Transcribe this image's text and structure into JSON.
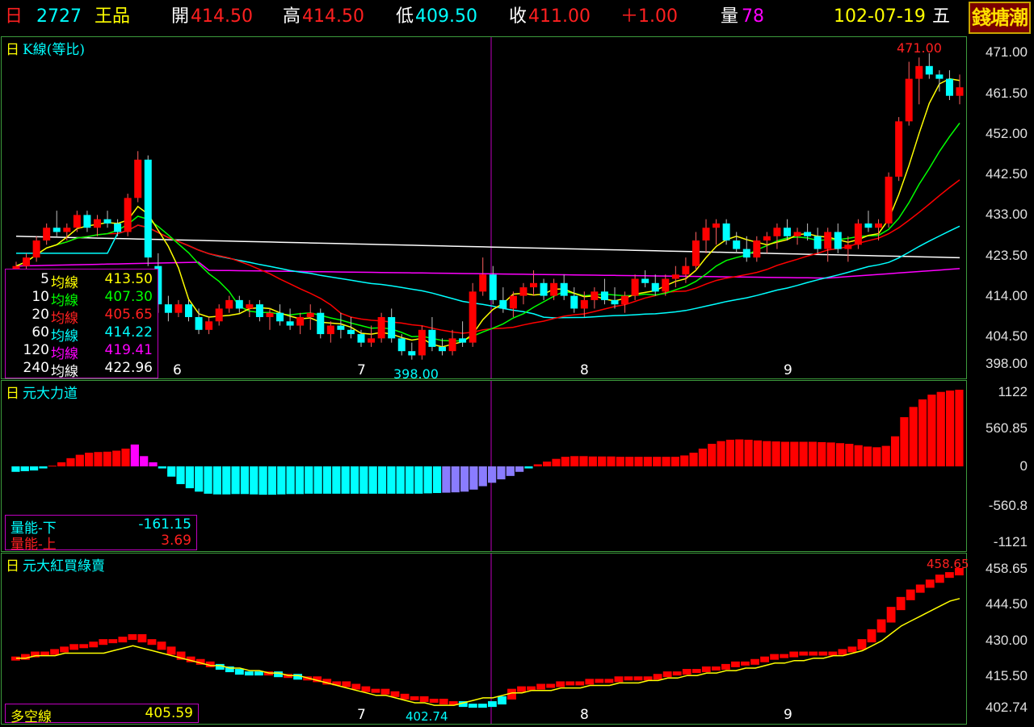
{
  "topbar": {
    "period": "日",
    "code": "2727",
    "name": "王品",
    "open_label": "開",
    "open": "414.50",
    "high_label": "高",
    "high": "414.50",
    "low_label": "低",
    "low": "409.50",
    "close_label": "收",
    "close": "411.00",
    "change": "＋1.00",
    "volume_label": "量",
    "volume": "78",
    "date": "102-07-19",
    "weekday": "五",
    "logo": "錢塘潮"
  },
  "colors": {
    "up": "#ff0000",
    "down": "#00ffff",
    "ma5": "#ffff00",
    "ma10": "#00ff00",
    "ma20": "#ff0000",
    "ma60": "#00ffff",
    "ma120": "#ff00ff",
    "ma240": "#ffffff",
    "grid": "#3c9c3c",
    "cursor": "#c000c0"
  },
  "panel1": {
    "title_prefix": "日",
    "title": "K線(等比)",
    "max_label": "471.00",
    "min_label": "398.00",
    "axis_ticks": [
      "471.00",
      "461.50",
      "452.00",
      "442.50",
      "433.00",
      "423.50",
      "414.00",
      "404.50",
      "398.00"
    ],
    "months": [
      "6",
      "7",
      "8",
      "9"
    ],
    "legend": [
      {
        "period": "5",
        "label": "均線",
        "value": "413.50"
      },
      {
        "period": "10",
        "label": "均線",
        "value": "407.30"
      },
      {
        "period": "20",
        "label": "均線",
        "value": "405.65"
      },
      {
        "period": "60",
        "label": "均線",
        "value": "414.22"
      },
      {
        "period": "120",
        "label": "均線",
        "value": "419.41"
      },
      {
        "period": "240",
        "label": "均線",
        "value": "422.96"
      }
    ]
  },
  "panel2": {
    "title_prefix": "日",
    "title": "元大力道",
    "axis_ticks": [
      "1122",
      "560.85",
      "0",
      "-560.8",
      "-1121"
    ],
    "legend": [
      {
        "label": "量能-下",
        "value": "-161.15"
      },
      {
        "label": "量能-上",
        "value": "3.69"
      }
    ]
  },
  "panel3": {
    "title_prefix": "日",
    "title": "元大紅買綠賣",
    "max_label": "458.65",
    "min_label": "402.74",
    "axis_ticks": [
      "458.65",
      "444.50",
      "430.00",
      "415.50",
      "402.74"
    ],
    "months": [
      "7",
      "8",
      "9"
    ],
    "legend": [
      {
        "label": "多空線",
        "value": "405.59"
      }
    ]
  },
  "chart_data": [
    {
      "type": "candlestick",
      "title": "K線(等比)",
      "ylim": [
        398.0,
        471.0
      ],
      "candles": [
        [
          420,
          422,
          419,
          421
        ],
        [
          421,
          424,
          420,
          423
        ],
        [
          423,
          428,
          422,
          427
        ],
        [
          427,
          431,
          426,
          430
        ],
        [
          430,
          434,
          428,
          429
        ],
        [
          429,
          431,
          427,
          430
        ],
        [
          430,
          434,
          429,
          433
        ],
        [
          433,
          434,
          429,
          430
        ],
        [
          430,
          433,
          428,
          432
        ],
        [
          432,
          434,
          430,
          431
        ],
        [
          431,
          432,
          428,
          429
        ],
        [
          429,
          438,
          428,
          437
        ],
        [
          437,
          448,
          436,
          446
        ],
        [
          446,
          447,
          421,
          423
        ],
        [
          421,
          424,
          410,
          412
        ],
        [
          412,
          414,
          408,
          410
        ],
        [
          410,
          413,
          409,
          412
        ],
        [
          412,
          413,
          408,
          409
        ],
        [
          409,
          411,
          405,
          406
        ],
        [
          406,
          409,
          405,
          408
        ],
        [
          408,
          412,
          407,
          411
        ],
        [
          411,
          414,
          410,
          413
        ],
        [
          413,
          414,
          410,
          411
        ],
        [
          411,
          413,
          409,
          412
        ],
        [
          412,
          413,
          408,
          409
        ],
        [
          409,
          411,
          406,
          410
        ],
        [
          410,
          412,
          407,
          408
        ],
        [
          408,
          411,
          406,
          407
        ],
        [
          407,
          410,
          405,
          409
        ],
        [
          409,
          412,
          406,
          410
        ],
        [
          410,
          411,
          404,
          405
        ],
        [
          405,
          408,
          403,
          407
        ],
        [
          407,
          410,
          404,
          406
        ],
        [
          406,
          409,
          404,
          405
        ],
        [
          405,
          406,
          402,
          403
        ],
        [
          403,
          407,
          402,
          404
        ],
        [
          404,
          410,
          403,
          409
        ],
        [
          409,
          411,
          403,
          404
        ],
        [
          404,
          405,
          400,
          401
        ],
        [
          401,
          403,
          399,
          400
        ],
        [
          400,
          407,
          399,
          406
        ],
        [
          406,
          409,
          401,
          402
        ],
        [
          402,
          404,
          400,
          401
        ],
        [
          401,
          406,
          400,
          404
        ],
        [
          404,
          408,
          402,
          403
        ],
        [
          403,
          417,
          402,
          415
        ],
        [
          415,
          423,
          414,
          419
        ],
        [
          419,
          421,
          412,
          413
        ],
        [
          413,
          416,
          410,
          411
        ],
        [
          411,
          415,
          409,
          414
        ],
        [
          414,
          417,
          412,
          416
        ],
        [
          416,
          420,
          414,
          417
        ],
        [
          417,
          418,
          413,
          414
        ],
        [
          414,
          418,
          413,
          417
        ],
        [
          417,
          419,
          413,
          414
        ],
        [
          414,
          416,
          410,
          411
        ],
        [
          411,
          415,
          409,
          413
        ],
        [
          413,
          416,
          411,
          415
        ],
        [
          415,
          418,
          412,
          413
        ],
        [
          413,
          416,
          411,
          412
        ],
        [
          412,
          415,
          410,
          414
        ],
        [
          414,
          419,
          413,
          418
        ],
        [
          418,
          420,
          416,
          417
        ],
        [
          417,
          419,
          414,
          415
        ],
        [
          415,
          419,
          414,
          418
        ],
        [
          418,
          421,
          416,
          419
        ],
        [
          419,
          423,
          417,
          421
        ],
        [
          421,
          429,
          420,
          427
        ],
        [
          427,
          432,
          424,
          430
        ],
        [
          430,
          432,
          426,
          431
        ],
        [
          431,
          432,
          426,
          427
        ],
        [
          427,
          429,
          424,
          425
        ],
        [
          425,
          428,
          422,
          423
        ],
        [
          423,
          428,
          422,
          427
        ],
        [
          427,
          429,
          424,
          428
        ],
        [
          428,
          431,
          425,
          430
        ],
        [
          430,
          432,
          427,
          428
        ],
        [
          428,
          430,
          426,
          429
        ],
        [
          429,
          431,
          427,
          428
        ],
        [
          428,
          430,
          424,
          425
        ],
        [
          425,
          430,
          422,
          429
        ],
        [
          429,
          431,
          424,
          425
        ],
        [
          425,
          428,
          422,
          426
        ],
        [
          426,
          432,
          425,
          431
        ],
        [
          431,
          434,
          429,
          430
        ],
        [
          430,
          432,
          427,
          431
        ],
        [
          431,
          443,
          430,
          442
        ],
        [
          442,
          456,
          441,
          455
        ],
        [
          455,
          469,
          454,
          465
        ],
        [
          465,
          470,
          459,
          468
        ],
        [
          468,
          471,
          465,
          466
        ],
        [
          466,
          467,
          462,
          465
        ],
        [
          465,
          467,
          460,
          461
        ],
        [
          461,
          466,
          459,
          463
        ]
      ],
      "ma_values": {
        "MA5": 413.5,
        "MA10": 407.3,
        "MA20": 405.65,
        "MA60": 414.22,
        "MA120": 419.41,
        "MA240": 422.96
      }
    },
    {
      "type": "bar",
      "title": "元大力道",
      "ylim": [
        -1121,
        1122
      ],
      "values": [
        -80,
        -70,
        -60,
        -30,
        10,
        60,
        120,
        170,
        200,
        210,
        215,
        230,
        260,
        320,
        150,
        60,
        -30,
        -150,
        -260,
        -320,
        -370,
        -400,
        -410,
        -410,
        -405,
        -405,
        -410,
        -415,
        -415,
        -410,
        -405,
        -405,
        -400,
        -400,
        -400,
        -400,
        -400,
        -400,
        -400,
        -400,
        -400,
        -400,
        -400,
        -400,
        -400,
        -395,
        -390,
        -385,
        -380,
        -370,
        -340,
        -290,
        -240,
        -190,
        -140,
        -80,
        -30,
        30,
        70,
        110,
        140,
        150,
        150,
        145,
        145,
        145,
        140,
        140,
        140,
        140,
        140,
        140,
        140,
        160,
        200,
        260,
        330,
        370,
        390,
        395,
        390,
        380,
        370,
        365,
        360,
        360,
        360,
        360,
        355,
        350,
        340,
        330,
        310,
        290,
        280,
        300,
        440,
        720,
        870,
        980,
        1050,
        1090,
        1110,
        1122
      ],
      "upper": "3.69",
      "lower": "-161.15"
    },
    {
      "type": "bar+line",
      "title": "元大紅買綠賣",
      "ylim": [
        402.74,
        458.65
      ],
      "bars": [
        423,
        424,
        425,
        425,
        426,
        427,
        428,
        428,
        429,
        430,
        430,
        431,
        432,
        430,
        429,
        427,
        425,
        423,
        422,
        421,
        420,
        419,
        418,
        417,
        417,
        417,
        417,
        416,
        416,
        415,
        415,
        414,
        413,
        413,
        412,
        411,
        410,
        410,
        409,
        408,
        407,
        407,
        406,
        406,
        405,
        405,
        404,
        404,
        404,
        405,
        407,
        410,
        411,
        411,
        412,
        412,
        413,
        413,
        413,
        414,
        414,
        414,
        415,
        415,
        415,
        415,
        416,
        417,
        417,
        418,
        418,
        419,
        419,
        420,
        421,
        421,
        422,
        423,
        424,
        424,
        425,
        425,
        425,
        425,
        425,
        426,
        427,
        430,
        434,
        438,
        443,
        447,
        450,
        452,
        454,
        456,
        457,
        458.65
      ],
      "line": [
        423,
        423,
        424,
        424,
        424,
        425,
        425,
        425,
        425,
        425,
        426,
        427,
        428,
        427,
        426,
        425,
        424,
        423,
        422,
        421,
        420,
        420,
        419,
        419,
        418,
        418,
        417,
        417,
        416,
        416,
        415,
        414,
        413,
        412,
        411,
        410,
        409,
        408,
        408,
        407,
        406,
        405,
        405,
        404,
        404,
        404,
        405,
        406,
        407,
        407,
        408,
        409,
        409,
        410,
        410,
        410,
        411,
        411,
        411,
        412,
        412,
        412,
        413,
        413,
        413,
        414,
        414,
        415,
        415,
        416,
        416,
        417,
        417,
        418,
        418,
        419,
        419,
        420,
        421,
        421,
        422,
        422,
        423,
        423,
        424,
        424,
        425,
        426,
        428,
        430,
        433,
        436,
        438,
        440,
        442,
        444,
        446,
        447
      ],
      "multi_empty_line": "405.59"
    }
  ]
}
